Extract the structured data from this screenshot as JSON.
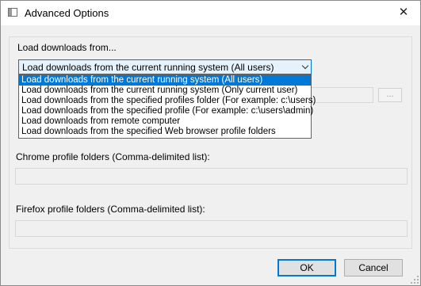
{
  "window": {
    "title": "Advanced Options",
    "icon": "app-window-icon",
    "close_symbol": "✕"
  },
  "load_group": {
    "label": "Load downloads from...",
    "selected_value": "Load downloads from the current running system (All users)",
    "options": [
      "Load downloads from the current running system (All users)",
      "Load downloads from the current running system (Only current user)",
      "Load downloads from the specified profiles folder (For example: c:\\users)",
      "Load downloads from the specified profile (For example: c:\\users\\admin)",
      "Load downloads from remote computer",
      "Load downloads from the specified Web browser profile folders"
    ],
    "selected_index": 0,
    "browse_label": "..."
  },
  "chrome": {
    "label": "Chrome profile folders (Comma-delimited list):",
    "value": ""
  },
  "firefox": {
    "label": "Firefox profile folders (Comma-delimited list):",
    "value": ""
  },
  "buttons": {
    "ok": "OK",
    "cancel": "Cancel"
  },
  "colors": {
    "accent": "#0078d7",
    "selection_fill": "#e5f1fb"
  }
}
